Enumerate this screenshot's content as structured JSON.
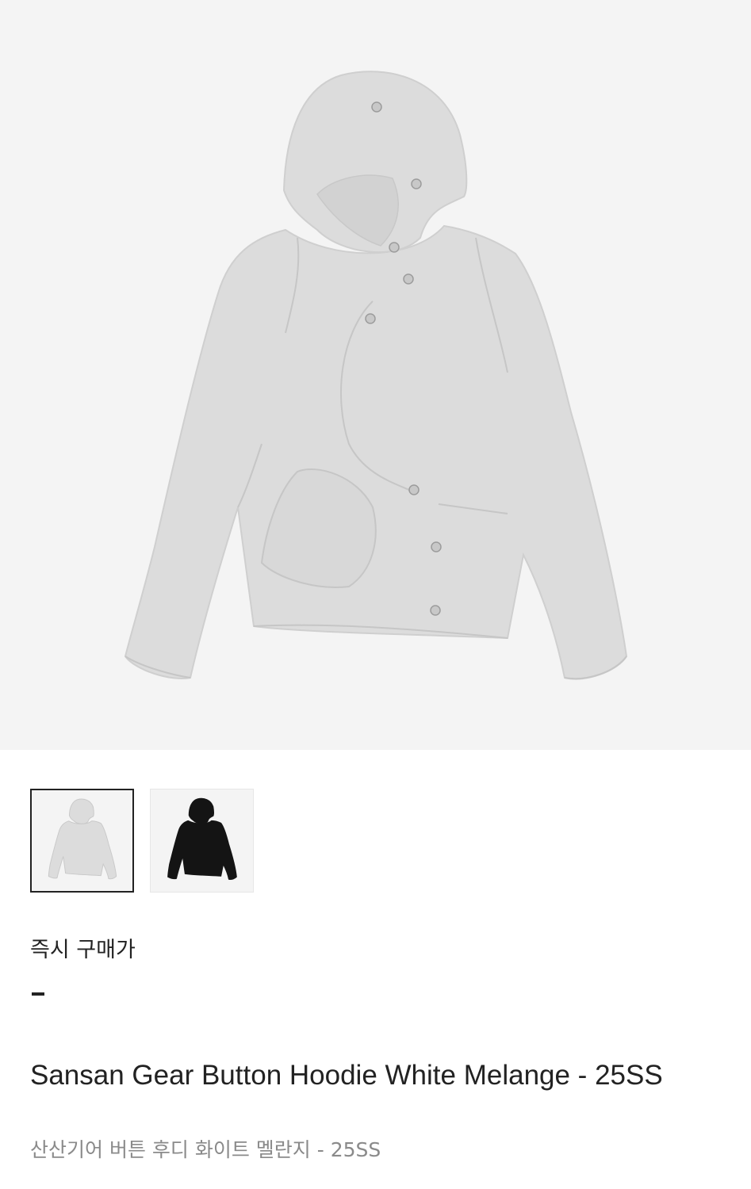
{
  "product": {
    "main_image": {
      "icon": "hoodie-image",
      "color": "#dcdcdc"
    },
    "thumbnails": [
      {
        "icon": "hoodie-white-melange-thumbnail",
        "color": "#dcdcdc",
        "selected": true
      },
      {
        "icon": "hoodie-black-thumbnail",
        "color": "#141414",
        "selected": false
      }
    ],
    "price_label": "즉시 구매가",
    "price_value": "-",
    "title_en": "Sansan Gear Button Hoodie White Melange - 25SS",
    "title_ko": "산산기어 버튼 후디 화이트 멜란지 - 25SS"
  },
  "colors": {
    "background": "#ffffff",
    "image_background": "#f4f4f4",
    "text_primary": "#222222",
    "text_secondary": "#8a8a8a"
  }
}
